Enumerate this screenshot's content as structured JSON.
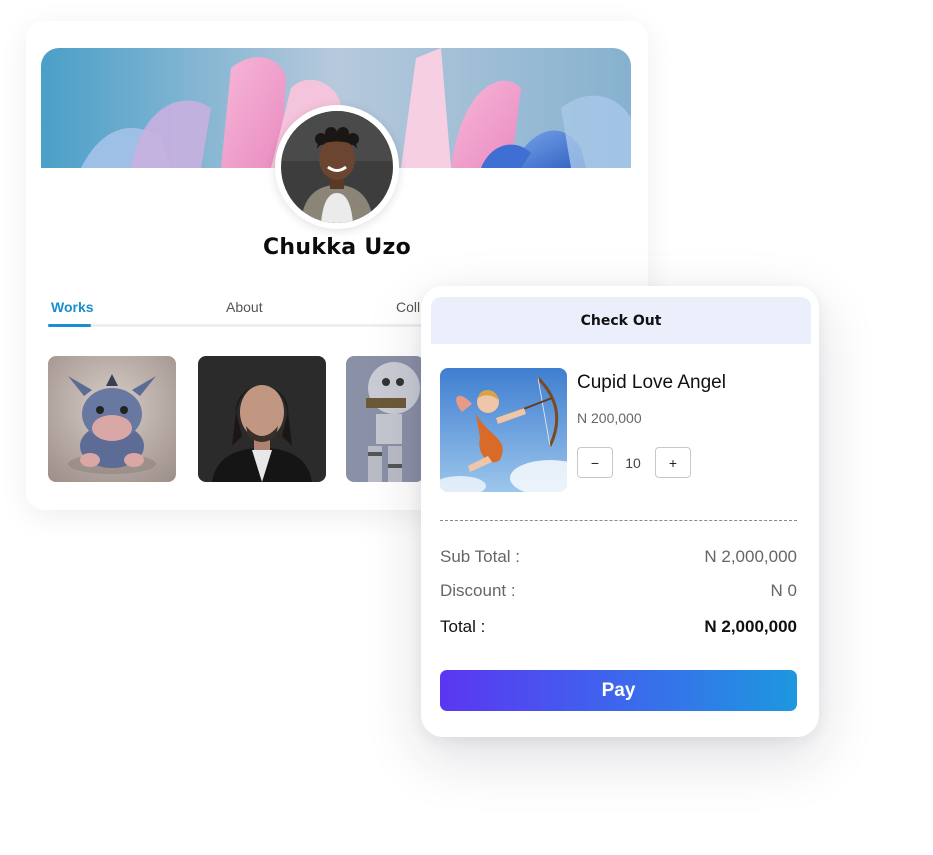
{
  "profile": {
    "name": "Chukka Uzo",
    "tabs": [
      {
        "label": "Works",
        "active": true
      },
      {
        "label": "About",
        "active": false
      },
      {
        "label": "Coll",
        "active": false
      }
    ],
    "works": [
      {
        "icon": "donkey-plush-artwork"
      },
      {
        "icon": "man-portrait-artwork"
      },
      {
        "icon": "robot-artwork"
      }
    ]
  },
  "checkout": {
    "title": "Check Out",
    "product": {
      "name": "Cupid Love Angel",
      "price": "N 200,000",
      "quantity": "10",
      "decrement": "−",
      "increment": "+"
    },
    "summary": {
      "subtotal_label": "Sub Total :",
      "subtotal_value": "N 2,000,000",
      "discount_label": "Discount :",
      "discount_value": "N 0",
      "total_label": "Total :",
      "total_value": "N 2,000,000"
    },
    "pay_label": "Pay"
  },
  "colors": {
    "accent": "#1a8fd0",
    "header_bg": "#ebeffb",
    "pay_gradient_start": "#5b36f2",
    "pay_gradient_end": "#1d98df"
  }
}
